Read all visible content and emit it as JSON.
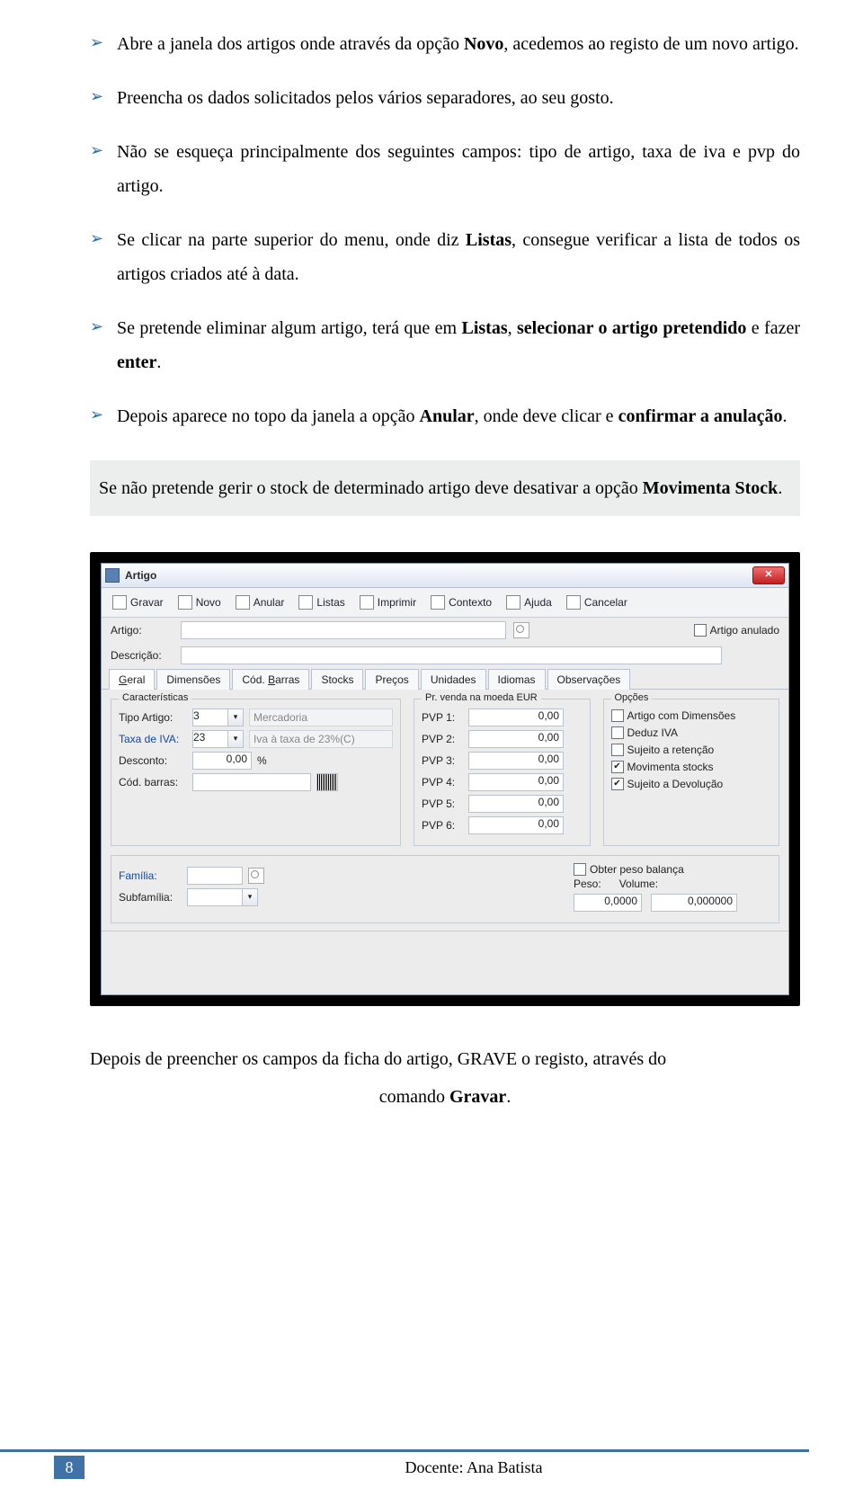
{
  "bullets": [
    {
      "pre": "Abre a janela dos artigos onde através da opção ",
      "b1": "Novo",
      "post": ", acedemos ao registo de um novo artigo."
    },
    {
      "plain": "Preencha os dados solicitados pelos vários separadores, ao seu gosto."
    },
    {
      "plain": "Não se esqueça principalmente dos seguintes campos: tipo de artigo, taxa de iva e pvp do artigo."
    },
    {
      "pre": "Se clicar na parte superior do menu, onde diz ",
      "b1": "Listas",
      "post": ", consegue verificar a lista de todos os artigos criados até à data."
    },
    {
      "pre": "Se pretende eliminar algum artigo, terá que em ",
      "b1": "Listas",
      "mid": ", ",
      "b2": "selecionar o artigo pretendido",
      "post2": " e fazer ",
      "b3": "enter",
      "post3": "."
    },
    {
      "pre": "Depois aparece no topo da janela a opção ",
      "b1": "Anular",
      "mid": ", onde deve clicar e ",
      "b2": "confirmar a anulação",
      "post2": "."
    }
  ],
  "note": {
    "pre": "Se não pretende gerir o stock de determinado artigo deve desativar a opção ",
    "b1": "Movimenta Stock",
    "post": "."
  },
  "win": {
    "title": "Artigo",
    "close": "✕",
    "toolbar": [
      "Gravar",
      "Novo",
      "Anular",
      "Listas",
      "Imprimir",
      "Contexto",
      "Ajuda",
      "Cancelar"
    ],
    "artigo_lbl": "Artigo:",
    "artigo_anulado": "Artigo anulado",
    "descricao_lbl": "Descrição:",
    "tabs": [
      "Geral",
      "Dimensões",
      "Cód. Barras",
      "Stocks",
      "Preços",
      "Unidades",
      "Idiomas",
      "Observações"
    ],
    "caract": {
      "legend": "Características",
      "tipo_lbl": "Tipo Artigo:",
      "tipo_val": "3",
      "tipo_name": "Mercadoria",
      "iva_lbl": "Taxa de IVA:",
      "iva_val": "23",
      "iva_name": "Iva à taxa de 23%(C)",
      "desc_lbl": "Desconto:",
      "desc_val": "0,00",
      "desc_pct": "%",
      "cod_lbl": "Cód. barras:"
    },
    "pvp": {
      "legend": "Pr. venda na moeda EUR",
      "rows": [
        [
          "PVP 1:",
          "0,00"
        ],
        [
          "PVP 2:",
          "0,00"
        ],
        [
          "PVP 3:",
          "0,00"
        ],
        [
          "PVP 4:",
          "0,00"
        ],
        [
          "PVP 5:",
          "0,00"
        ],
        [
          "PVP 6:",
          "0,00"
        ]
      ]
    },
    "opts": {
      "legend": "Opções",
      "items": [
        [
          "Artigo com Dimensões",
          false
        ],
        [
          "Deduz IVA",
          false
        ],
        [
          "Sujeito a retenção",
          false
        ],
        [
          "Movimenta stocks",
          true
        ],
        [
          "Sujeito a Devolução",
          true
        ]
      ]
    },
    "panel2": {
      "familia_lbl": "Família:",
      "sub_lbl": "Subfamília:",
      "balanca": "Obter peso balança",
      "peso_lbl": "Peso:",
      "peso_val": "0,0000",
      "vol_lbl": "Volume:",
      "vol_val": "0,000000"
    }
  },
  "closing": {
    "line1": "Depois de preencher os campos da ficha do artigo, GRAVE o registo, através do",
    "line2_pre": "comando ",
    "line2_b": "Gravar",
    "line2_post": "."
  },
  "footer": {
    "page": "8",
    "doc": "Docente: Ana Batista"
  }
}
